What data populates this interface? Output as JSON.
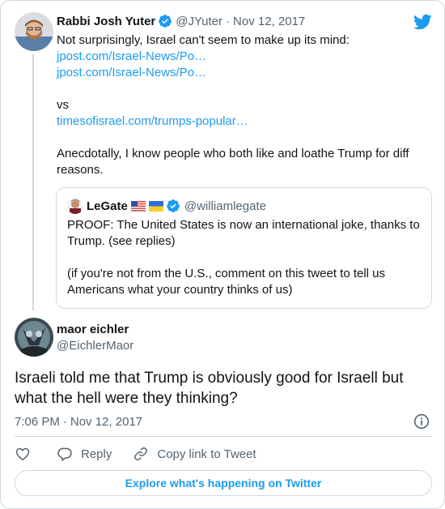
{
  "parent_tweet": {
    "name": "Rabbi Josh Yuter",
    "handle": "@JYuter",
    "separator": "·",
    "date": "Nov 12, 2017",
    "lines": [
      {
        "text": "Not surprisingly, Israel can't seem to make up its mind:",
        "link": false
      },
      {
        "text": "jpost.com/Israel-News/Po…",
        "link": true
      },
      {
        "text": "jpost.com/Israel-News/Po…",
        "link": true
      },
      {
        "text": "",
        "link": false
      },
      {
        "text": "vs",
        "link": false
      },
      {
        "text": "timesofisrael.com/trumps-popular…",
        "link": true
      },
      {
        "text": "",
        "link": false
      },
      {
        "text": "Anecdotally, I know people who both like and loathe Trump for diff",
        "link": false
      },
      {
        "text": "reasons.",
        "link": false
      }
    ]
  },
  "quoted_tweet": {
    "name": "LeGate",
    "handle": "@williamlegate",
    "flags": [
      "us-flag-icon",
      "ukraine-flag-icon"
    ],
    "lines": [
      "PROOF: The United States is now an international joke, thanks to",
      "Trump. (see replies)",
      "",
      "(if you're not from the U.S., comment on this tweet to tell us",
      "Americans what your country thinks of us)"
    ]
  },
  "main_tweet": {
    "name": "maor eichler",
    "handle": "@EichlerMaor",
    "text_lines": [
      "Israeli told me that Trump is obviously good for Israell but",
      "what the hell were they thinking?"
    ],
    "time": "7:06 PM",
    "separator": "·",
    "date": "Nov 12, 2017"
  },
  "actions": {
    "like_icon": "heart-icon",
    "reply_label": "Reply",
    "copy_link_label": "Copy link to Tweet"
  },
  "explore_label": "Explore what's happening on Twitter",
  "colors": {
    "link": "#1d9bf0",
    "text": "#0f1419",
    "secondary": "#536471",
    "border": "#cfd9de",
    "verified": "#1d9bf0"
  }
}
